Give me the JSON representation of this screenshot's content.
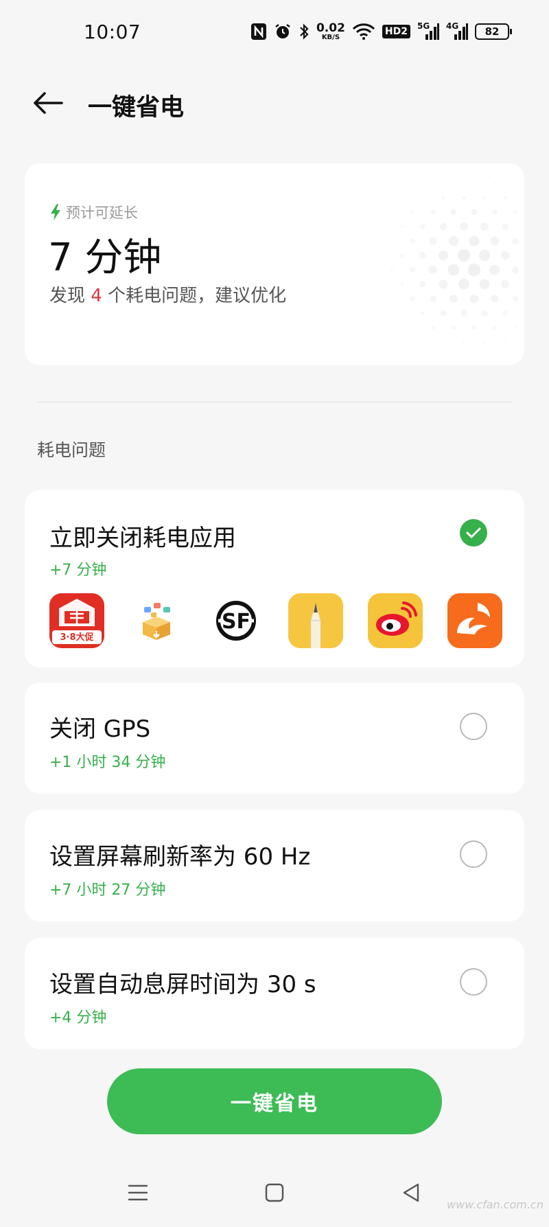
{
  "status_bar": {
    "time": "10:07",
    "net_speed_value": "0.02",
    "net_speed_unit": "KB/S",
    "hd_badge": "HD2",
    "signal_1_label": "5G",
    "signal_2_label": "4G",
    "battery_level": "82",
    "icons": [
      "nfc-icon",
      "alarm-icon",
      "bluetooth-icon",
      "wifi-icon",
      "signal-icon",
      "battery-icon"
    ]
  },
  "header": {
    "title": "一键省电"
  },
  "summary": {
    "estimate_label": "预计可延长",
    "estimate_value": "7 分钟",
    "issues_prefix": "发现 ",
    "issues_count": "4",
    "issues_suffix": " 个耗电问题，建议优化"
  },
  "section": {
    "title": "耗电问题"
  },
  "issues": [
    {
      "title": "立即关闭耗电应用",
      "gain": "+7 分钟",
      "checked": true
    },
    {
      "title": "关闭 GPS",
      "gain": "+1 小时 34 分钟",
      "checked": false
    },
    {
      "title": "设置屏幕刷新率为 60 Hz",
      "gain": "+7 小时 27 分钟",
      "checked": false
    },
    {
      "title": "设置自动息屏时间为 30 s",
      "gain": "+4 分钟",
      "checked": false
    }
  ],
  "apps": {
    "pinduoduo_badge": "3·8大促",
    "sf_mark": "SF"
  },
  "colors": {
    "accent_green": "#3dbb55",
    "warning_red": "#d93640",
    "background": "#f6f6f6"
  },
  "footer": {
    "button_label": "一键省电",
    "watermark": "www.cfan.com.cn"
  }
}
